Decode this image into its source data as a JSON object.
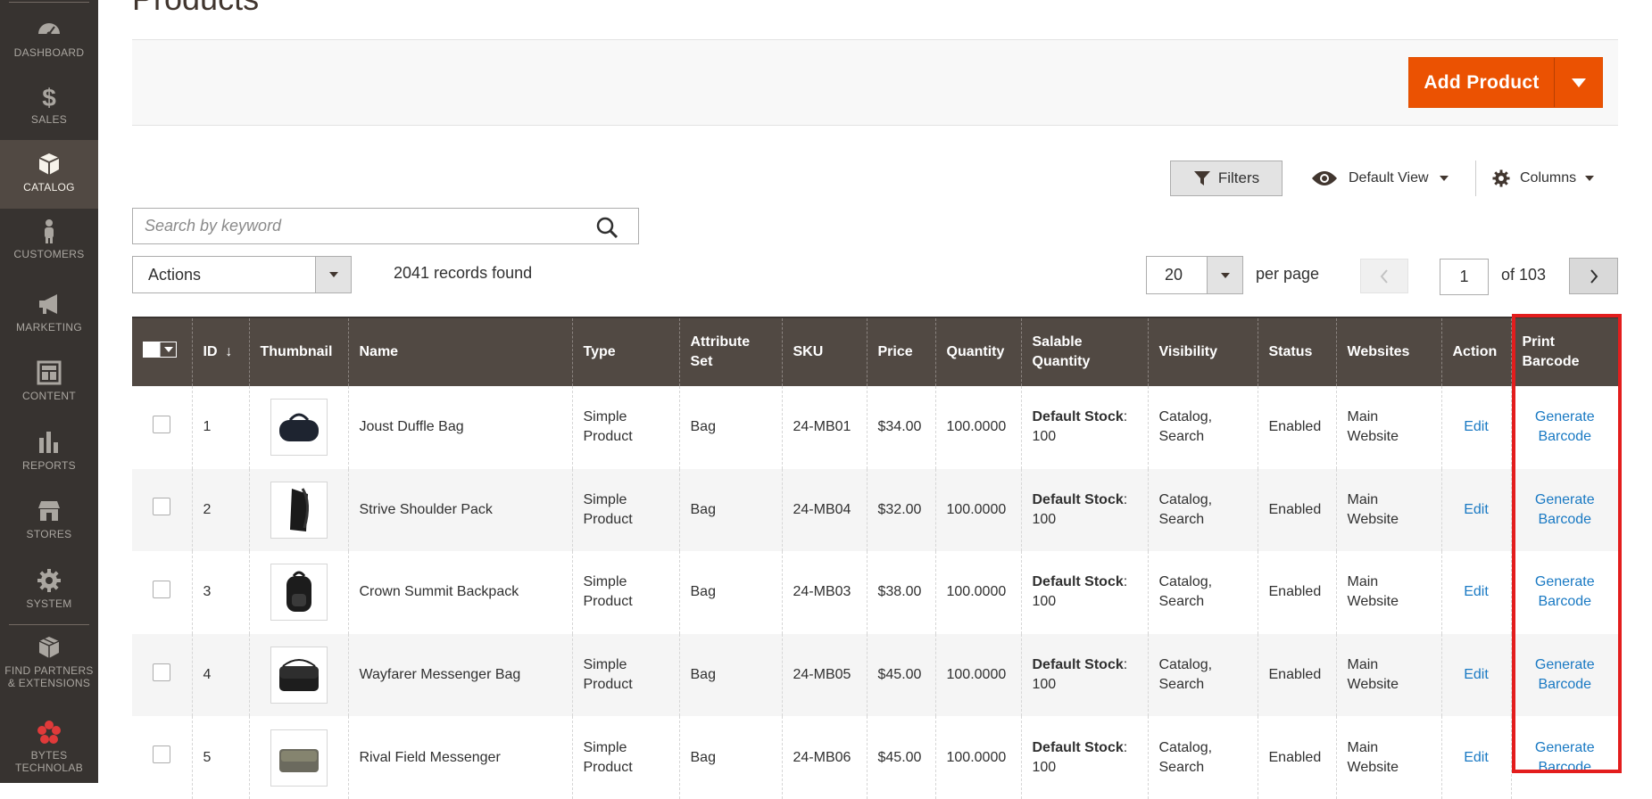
{
  "sidebar": {
    "items": [
      {
        "label": "DASHBOARD",
        "icon": "dashboard-icon"
      },
      {
        "label": "SALES",
        "icon": "dollar-icon"
      },
      {
        "label": "CATALOG",
        "icon": "cube-icon",
        "active": true
      },
      {
        "label": "CUSTOMERS",
        "icon": "person-icon"
      },
      {
        "label": "MARKETING",
        "icon": "megaphone-icon"
      },
      {
        "label": "CONTENT",
        "icon": "layout-icon"
      },
      {
        "label": "REPORTS",
        "icon": "bar-chart-icon"
      },
      {
        "label": "STORES",
        "icon": "storefront-icon"
      },
      {
        "label": "SYSTEM",
        "icon": "gear-icon"
      },
      {
        "label": "FIND PARTNERS & EXTENSIONS",
        "icon": "blocks-icon"
      },
      {
        "label": "BYTES TECHNOLAB",
        "icon": "flower-logo-icon"
      }
    ]
  },
  "page": {
    "title": "Products"
  },
  "toolbar": {
    "add_product_label": "Add Product",
    "filters_label": "Filters",
    "view_label": "Default View",
    "columns_label": "Columns"
  },
  "search": {
    "placeholder": "Search by keyword",
    "value": ""
  },
  "grid_controls": {
    "actions_label": "Actions",
    "records_found": "2041 records found",
    "per_page_value": "20",
    "per_page_label": "per page",
    "current_page": "1",
    "total_pages_label": "of 103"
  },
  "columns": {
    "id": "ID",
    "sort_arrow": "↓",
    "thumbnail": "Thumbnail",
    "name": "Name",
    "type": "Type",
    "attribute_set": "Attribute Set",
    "sku": "SKU",
    "price": "Price",
    "quantity": "Quantity",
    "salable_quantity": "Salable Quantity",
    "visibility": "Visibility",
    "status": "Status",
    "websites": "Websites",
    "action": "Action",
    "print_barcode": "Print Barcode"
  },
  "rows": [
    {
      "id": "1",
      "name": "Joust Duffle Bag",
      "type": "Simple Product",
      "attribute_set": "Bag",
      "sku": "24-MB01",
      "price": "$34.00",
      "quantity": "100.0000",
      "stock_label": "Default Stock",
      "stock_qty": "100",
      "visibility": "Catalog, Search",
      "status": "Enabled",
      "websites": "Main Website",
      "action": "Edit",
      "barcode": "Generate Barcode"
    },
    {
      "id": "2",
      "name": "Strive Shoulder Pack",
      "type": "Simple Product",
      "attribute_set": "Bag",
      "sku": "24-MB04",
      "price": "$32.00",
      "quantity": "100.0000",
      "stock_label": "Default Stock",
      "stock_qty": "100",
      "visibility": "Catalog, Search",
      "status": "Enabled",
      "websites": "Main Website",
      "action": "Edit",
      "barcode": "Generate Barcode"
    },
    {
      "id": "3",
      "name": "Crown Summit Backpack",
      "type": "Simple Product",
      "attribute_set": "Bag",
      "sku": "24-MB03",
      "price": "$38.00",
      "quantity": "100.0000",
      "stock_label": "Default Stock",
      "stock_qty": "100",
      "visibility": "Catalog, Search",
      "status": "Enabled",
      "websites": "Main Website",
      "action": "Edit",
      "barcode": "Generate Barcode"
    },
    {
      "id": "4",
      "name": "Wayfarer Messenger Bag",
      "type": "Simple Product",
      "attribute_set": "Bag",
      "sku": "24-MB05",
      "price": "$45.00",
      "quantity": "100.0000",
      "stock_label": "Default Stock",
      "stock_qty": "100",
      "visibility": "Catalog, Search",
      "status": "Enabled",
      "websites": "Main Website",
      "action": "Edit",
      "barcode": "Generate Barcode"
    },
    {
      "id": "5",
      "name": "Rival Field Messenger",
      "type": "Simple Product",
      "attribute_set": "Bag",
      "sku": "24-MB06",
      "price": "$45.00",
      "quantity": "100.0000",
      "stock_label": "Default Stock",
      "stock_qty": "100",
      "visibility": "Catalog, Search",
      "status": "Enabled",
      "websites": "Main Website",
      "action": "Edit",
      "barcode": "Generate Barcode"
    }
  ],
  "colors": {
    "sidebar_bg": "#373330",
    "sidebar_active_bg": "#514943",
    "grid_header_bg": "#514943",
    "accent": "#eb5202",
    "link": "#1979c3",
    "highlight": "#e31d1d"
  }
}
